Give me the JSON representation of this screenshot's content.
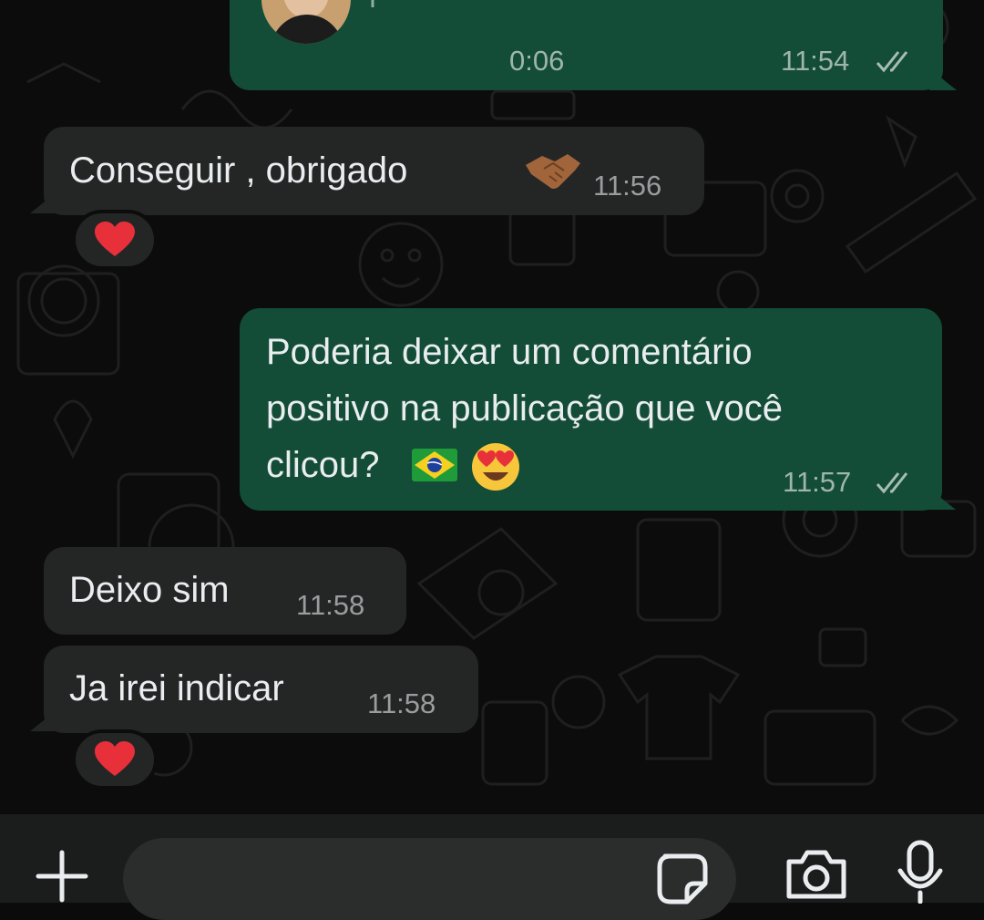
{
  "colors": {
    "outgoing_bubble": "#134d37",
    "incoming_bubble": "#242626",
    "background": "#0c0c0c",
    "read_tick": "#a8bdb4",
    "reaction_heart": "#e8303a"
  },
  "messages": [
    {
      "type": "voice",
      "direction": "outgoing",
      "duration": "0:06",
      "time": "11:54",
      "status_icon": "double-check-icon"
    },
    {
      "type": "text",
      "direction": "incoming",
      "text": "Conseguir , obrigado",
      "emoji": "handshake-icon",
      "time": "11:56",
      "reaction": "heart-icon"
    },
    {
      "type": "text",
      "direction": "outgoing",
      "lines": [
        "Poderia deixar um comentário",
        "positivo na publicação que você",
        "clicou?"
      ],
      "emojis": [
        "brazil-flag-icon",
        "heart-eyes-icon"
      ],
      "time": "11:57",
      "status_icon": "double-check-icon"
    },
    {
      "type": "text",
      "direction": "incoming",
      "text": "Deixo sim",
      "time": "11:58"
    },
    {
      "type": "text",
      "direction": "incoming",
      "text": "Ja irei indicar",
      "time": "11:58",
      "reaction": "heart-icon"
    }
  ],
  "input_bar": {
    "icons": [
      "plus-icon",
      "sticker-icon",
      "camera-icon",
      "microphone-icon"
    ]
  }
}
